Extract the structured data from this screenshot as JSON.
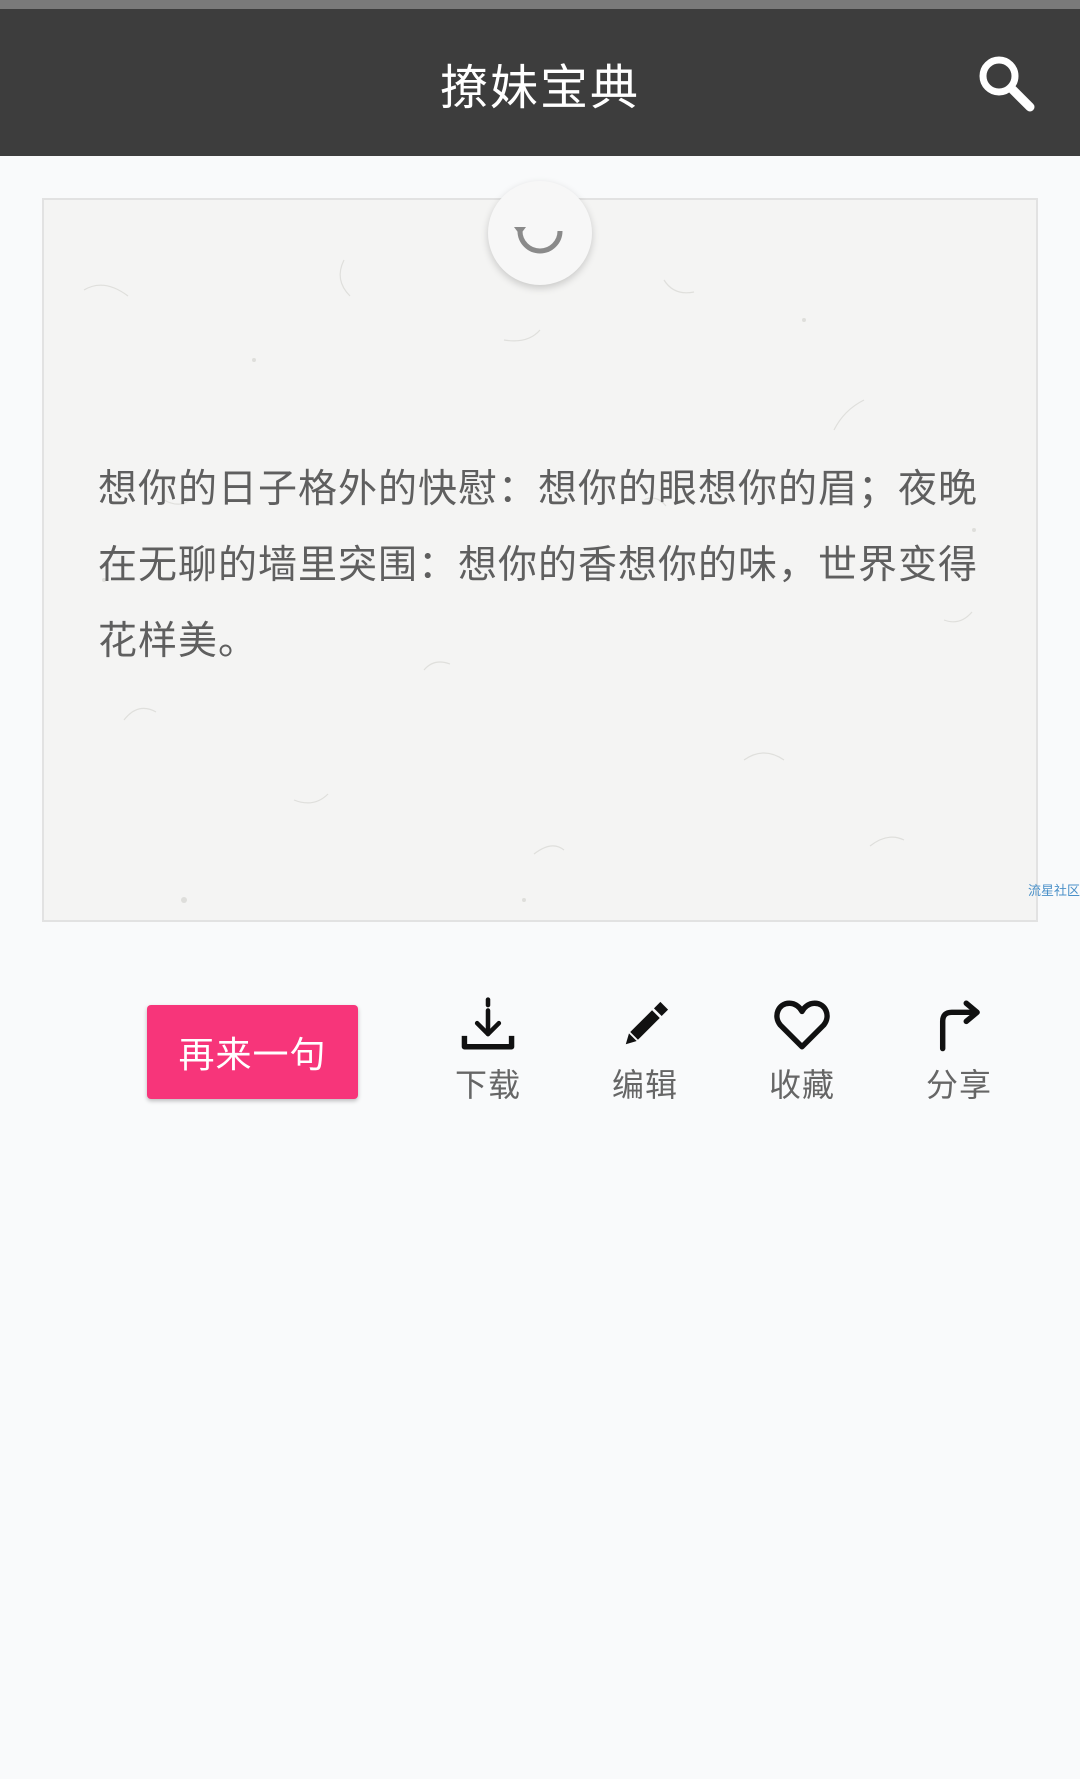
{
  "appbar": {
    "title": "撩妹宝典",
    "search_icon": "search-icon"
  },
  "card": {
    "refresh_icon": "refresh-icon",
    "quote": "想你的日子格外的快慰：想你的眼想你的眉；夜晚在无聊的墙里突围：想你的香想你的味，世界变得花样美。",
    "watermark": "流星社区"
  },
  "actions": {
    "more_label": "再来一句",
    "items": [
      {
        "label": "下载",
        "icon": "download-icon"
      },
      {
        "label": "编辑",
        "icon": "pencil-icon"
      },
      {
        "label": "收藏",
        "icon": "heart-icon"
      },
      {
        "label": "分享",
        "icon": "share-icon"
      }
    ]
  },
  "colors": {
    "appbar": "#3d3d3d",
    "accent": "#f7357a",
    "background": "#f9fafb"
  }
}
